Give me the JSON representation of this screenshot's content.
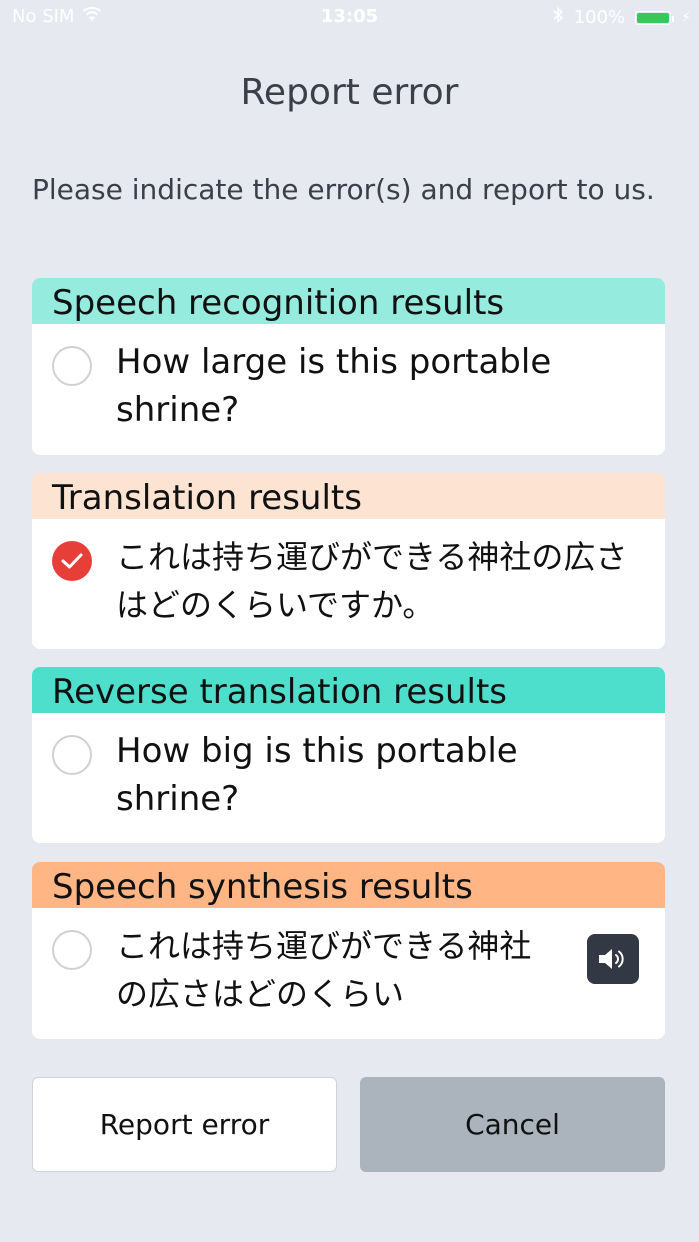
{
  "status_bar": {
    "carrier": "No SIM",
    "time": "13:05",
    "battery": "100%",
    "battery_level": 1.0,
    "battery_color": "#35c95a"
  },
  "title": "Report error",
  "instruction": "Please indicate the error(s) and report to us.",
  "sections": [
    {
      "header": "Speech recognition results",
      "text": "How large is this portable shrine?",
      "checked": false,
      "header_color": "#95ebde"
    },
    {
      "header": "Translation results",
      "text": "これは持ち運びができる神社の広さはどのくらいですか。",
      "checked": true,
      "header_color": "#fde3d2"
    },
    {
      "header": "Reverse translation results",
      "text": "How big is this portable shrine?",
      "checked": false,
      "header_color": "#4ddfcb"
    },
    {
      "header": "Speech synthesis results",
      "text": "これは持ち運びができる神社の広さはどのくらい",
      "checked": false,
      "header_color": "#ffb584",
      "speaker_icon": "speaker-icon"
    }
  ],
  "buttons": {
    "report": "Report error",
    "cancel": "Cancel"
  },
  "colors": {
    "background": "#e6e9f0",
    "checked": "#e63f37",
    "cancel_button": "#abb3bd"
  }
}
